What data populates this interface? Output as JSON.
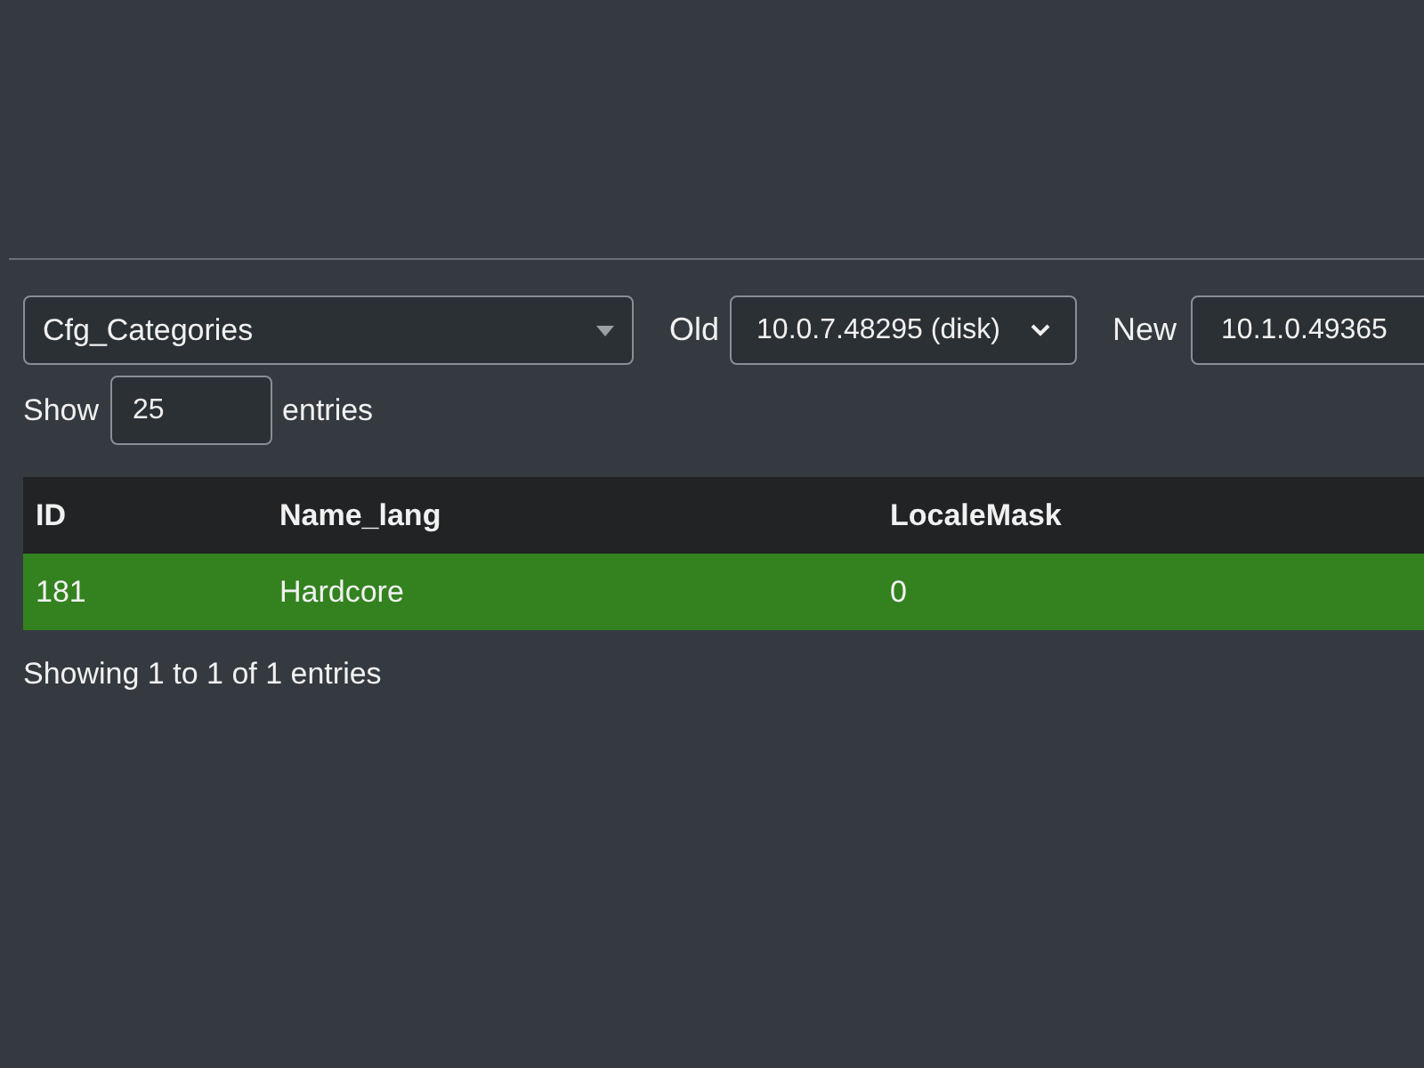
{
  "table_select": {
    "value": "Cfg_Categories"
  },
  "old_build": {
    "label": "Old",
    "value": "10.0.7.48295 (disk)"
  },
  "new_build": {
    "label": "New",
    "value": "10.1.0.49365"
  },
  "page_length": {
    "before": "Show",
    "value": "25",
    "after": "entries"
  },
  "table": {
    "columns": [
      "ID",
      "Name_lang",
      "LocaleMask"
    ],
    "rows": [
      {
        "color": "#33821f",
        "cells": [
          "181",
          "Hardcore",
          "0"
        ]
      }
    ]
  },
  "info": "Showing 1 to 1 of 1 entries"
}
